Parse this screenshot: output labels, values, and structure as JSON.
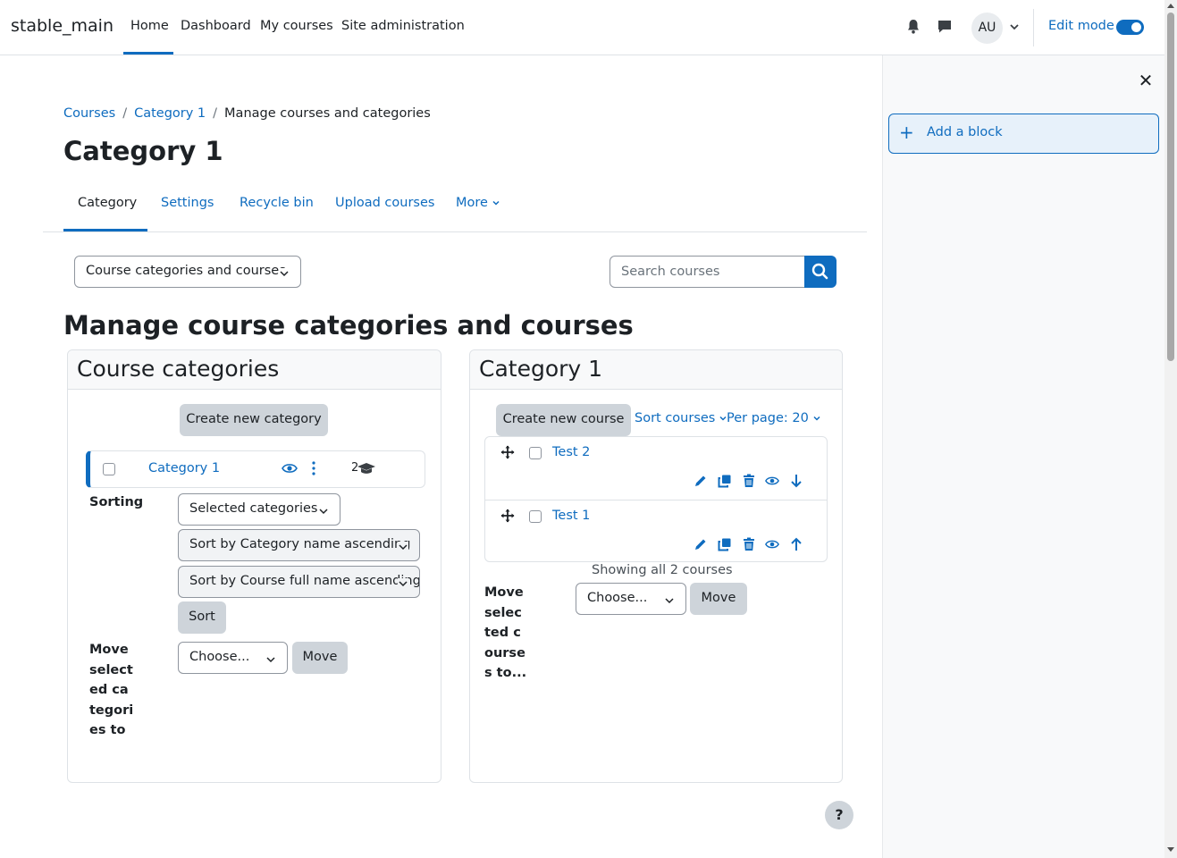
{
  "navbar": {
    "brand": "stable_main",
    "items": [
      "Home",
      "Dashboard",
      "My courses",
      "Site administration"
    ],
    "avatar_initials": "AU",
    "edit_mode_label": "Edit mode"
  },
  "drawer": {
    "add_block_label": "Add a block"
  },
  "breadcrumb": [
    "Courses",
    "Category 1",
    "Manage courses and categories"
  ],
  "page_title": "Category 1",
  "tabs": [
    "Category",
    "Settings",
    "Recycle bin",
    "Upload courses",
    "More"
  ],
  "view_select": "Course categories and courses",
  "search": {
    "placeholder": "Search courses"
  },
  "manage_title": "Manage course categories and courses",
  "categories_panel": {
    "title": "Course categories",
    "create_button": "Create new category",
    "category": {
      "name": "Category 1",
      "count": "2"
    },
    "sorting_label": "Sorting",
    "sort_select_1": "Selected categories",
    "sort_select_2": "Sort by Category name ascending",
    "sort_select_3": "Sort by Course full name ascending",
    "sort_button": "Sort",
    "move_label": "Move selected categories to",
    "move_select": "Choose...",
    "move_button": "Move"
  },
  "courses_panel": {
    "title": "Category 1",
    "create_button": "Create new course",
    "sort_courses": "Sort courses",
    "per_page": "Per page: 20",
    "courses": [
      "Test 2",
      "Test 1"
    ],
    "showing": "Showing all 2 courses",
    "move_label": "Move selected courses to...",
    "move_select": "Choose...",
    "move_button": "Move"
  },
  "help_label": "?",
  "colors": {
    "primary": "#0f6cbf",
    "button_grey": "#ced4da",
    "text": "#1d2125"
  }
}
